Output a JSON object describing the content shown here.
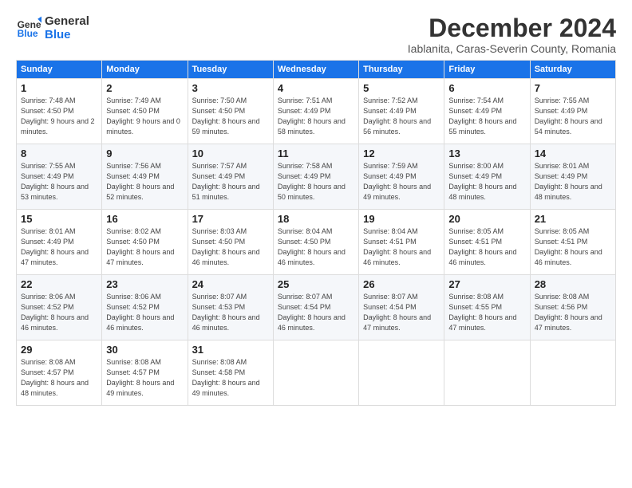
{
  "logo": {
    "line1": "General",
    "line2": "Blue"
  },
  "title": "December 2024",
  "location": "Iablanita, Caras-Severin County, Romania",
  "header": {
    "accent_color": "#1a73e8"
  },
  "days_of_week": [
    "Sunday",
    "Monday",
    "Tuesday",
    "Wednesday",
    "Thursday",
    "Friday",
    "Saturday"
  ],
  "weeks": [
    [
      {
        "day": "1",
        "sunrise": "Sunrise: 7:48 AM",
        "sunset": "Sunset: 4:50 PM",
        "daylight": "Daylight: 9 hours and 2 minutes."
      },
      {
        "day": "2",
        "sunrise": "Sunrise: 7:49 AM",
        "sunset": "Sunset: 4:50 PM",
        "daylight": "Daylight: 9 hours and 0 minutes."
      },
      {
        "day": "3",
        "sunrise": "Sunrise: 7:50 AM",
        "sunset": "Sunset: 4:50 PM",
        "daylight": "Daylight: 8 hours and 59 minutes."
      },
      {
        "day": "4",
        "sunrise": "Sunrise: 7:51 AM",
        "sunset": "Sunset: 4:49 PM",
        "daylight": "Daylight: 8 hours and 58 minutes."
      },
      {
        "day": "5",
        "sunrise": "Sunrise: 7:52 AM",
        "sunset": "Sunset: 4:49 PM",
        "daylight": "Daylight: 8 hours and 56 minutes."
      },
      {
        "day": "6",
        "sunrise": "Sunrise: 7:54 AM",
        "sunset": "Sunset: 4:49 PM",
        "daylight": "Daylight: 8 hours and 55 minutes."
      },
      {
        "day": "7",
        "sunrise": "Sunrise: 7:55 AM",
        "sunset": "Sunset: 4:49 PM",
        "daylight": "Daylight: 8 hours and 54 minutes."
      }
    ],
    [
      {
        "day": "8",
        "sunrise": "Sunrise: 7:55 AM",
        "sunset": "Sunset: 4:49 PM",
        "daylight": "Daylight: 8 hours and 53 minutes."
      },
      {
        "day": "9",
        "sunrise": "Sunrise: 7:56 AM",
        "sunset": "Sunset: 4:49 PM",
        "daylight": "Daylight: 8 hours and 52 minutes."
      },
      {
        "day": "10",
        "sunrise": "Sunrise: 7:57 AM",
        "sunset": "Sunset: 4:49 PM",
        "daylight": "Daylight: 8 hours and 51 minutes."
      },
      {
        "day": "11",
        "sunrise": "Sunrise: 7:58 AM",
        "sunset": "Sunset: 4:49 PM",
        "daylight": "Daylight: 8 hours and 50 minutes."
      },
      {
        "day": "12",
        "sunrise": "Sunrise: 7:59 AM",
        "sunset": "Sunset: 4:49 PM",
        "daylight": "Daylight: 8 hours and 49 minutes."
      },
      {
        "day": "13",
        "sunrise": "Sunrise: 8:00 AM",
        "sunset": "Sunset: 4:49 PM",
        "daylight": "Daylight: 8 hours and 48 minutes."
      },
      {
        "day": "14",
        "sunrise": "Sunrise: 8:01 AM",
        "sunset": "Sunset: 4:49 PM",
        "daylight": "Daylight: 8 hours and 48 minutes."
      }
    ],
    [
      {
        "day": "15",
        "sunrise": "Sunrise: 8:01 AM",
        "sunset": "Sunset: 4:49 PM",
        "daylight": "Daylight: 8 hours and 47 minutes."
      },
      {
        "day": "16",
        "sunrise": "Sunrise: 8:02 AM",
        "sunset": "Sunset: 4:50 PM",
        "daylight": "Daylight: 8 hours and 47 minutes."
      },
      {
        "day": "17",
        "sunrise": "Sunrise: 8:03 AM",
        "sunset": "Sunset: 4:50 PM",
        "daylight": "Daylight: 8 hours and 46 minutes."
      },
      {
        "day": "18",
        "sunrise": "Sunrise: 8:04 AM",
        "sunset": "Sunset: 4:50 PM",
        "daylight": "Daylight: 8 hours and 46 minutes."
      },
      {
        "day": "19",
        "sunrise": "Sunrise: 8:04 AM",
        "sunset": "Sunset: 4:51 PM",
        "daylight": "Daylight: 8 hours and 46 minutes."
      },
      {
        "day": "20",
        "sunrise": "Sunrise: 8:05 AM",
        "sunset": "Sunset: 4:51 PM",
        "daylight": "Daylight: 8 hours and 46 minutes."
      },
      {
        "day": "21",
        "sunrise": "Sunrise: 8:05 AM",
        "sunset": "Sunset: 4:51 PM",
        "daylight": "Daylight: 8 hours and 46 minutes."
      }
    ],
    [
      {
        "day": "22",
        "sunrise": "Sunrise: 8:06 AM",
        "sunset": "Sunset: 4:52 PM",
        "daylight": "Daylight: 8 hours and 46 minutes."
      },
      {
        "day": "23",
        "sunrise": "Sunrise: 8:06 AM",
        "sunset": "Sunset: 4:52 PM",
        "daylight": "Daylight: 8 hours and 46 minutes."
      },
      {
        "day": "24",
        "sunrise": "Sunrise: 8:07 AM",
        "sunset": "Sunset: 4:53 PM",
        "daylight": "Daylight: 8 hours and 46 minutes."
      },
      {
        "day": "25",
        "sunrise": "Sunrise: 8:07 AM",
        "sunset": "Sunset: 4:54 PM",
        "daylight": "Daylight: 8 hours and 46 minutes."
      },
      {
        "day": "26",
        "sunrise": "Sunrise: 8:07 AM",
        "sunset": "Sunset: 4:54 PM",
        "daylight": "Daylight: 8 hours and 47 minutes."
      },
      {
        "day": "27",
        "sunrise": "Sunrise: 8:08 AM",
        "sunset": "Sunset: 4:55 PM",
        "daylight": "Daylight: 8 hours and 47 minutes."
      },
      {
        "day": "28",
        "sunrise": "Sunrise: 8:08 AM",
        "sunset": "Sunset: 4:56 PM",
        "daylight": "Daylight: 8 hours and 47 minutes."
      }
    ],
    [
      {
        "day": "29",
        "sunrise": "Sunrise: 8:08 AM",
        "sunset": "Sunset: 4:57 PM",
        "daylight": "Daylight: 8 hours and 48 minutes."
      },
      {
        "day": "30",
        "sunrise": "Sunrise: 8:08 AM",
        "sunset": "Sunset: 4:57 PM",
        "daylight": "Daylight: 8 hours and 49 minutes."
      },
      {
        "day": "31",
        "sunrise": "Sunrise: 8:08 AM",
        "sunset": "Sunset: 4:58 PM",
        "daylight": "Daylight: 8 hours and 49 minutes."
      },
      null,
      null,
      null,
      null
    ]
  ]
}
